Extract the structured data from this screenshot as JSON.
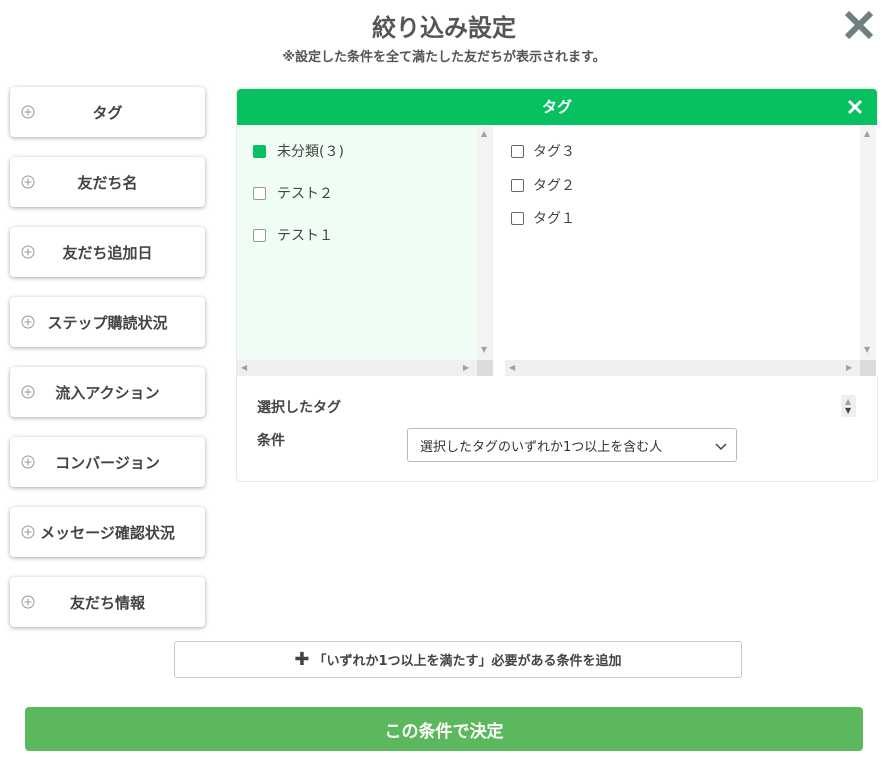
{
  "header": {
    "title": "絞り込み設定",
    "subtitle": "※設定した条件を全て満たした友だちが表示されます。"
  },
  "colors": {
    "accent": "#07c160",
    "confirm": "#5cb85c",
    "text": "#444444"
  },
  "sidebar": {
    "items": [
      {
        "label": "タグ",
        "icon": "plus-circle-icon"
      },
      {
        "label": "友だち名",
        "icon": "plus-circle-icon"
      },
      {
        "label": "友だち追加日",
        "icon": "plus-circle-icon"
      },
      {
        "label": "ステップ購読状況",
        "icon": "plus-circle-icon"
      },
      {
        "label": "流入アクション",
        "icon": "plus-circle-icon"
      },
      {
        "label": "コンバージョン",
        "icon": "plus-circle-icon"
      },
      {
        "label": "メッセージ確認状況",
        "icon": "plus-circle-icon"
      },
      {
        "label": "友だち情報",
        "icon": "plus-circle-icon"
      }
    ]
  },
  "tag_panel": {
    "title": "タグ",
    "folders": [
      {
        "label": "未分類(３)",
        "checked": true
      },
      {
        "label": "テスト２",
        "checked": false
      },
      {
        "label": "テスト１",
        "checked": false
      }
    ],
    "tags": [
      {
        "label": "タグ３",
        "checked": false
      },
      {
        "label": "タグ２",
        "checked": false
      },
      {
        "label": "タグ１",
        "checked": false
      }
    ],
    "selected_tags_label": "選択したタグ",
    "condition_label": "条件",
    "condition_value": "選択したタグのいずれか1つ以上を含む人"
  },
  "add_condition_label": "「いずれか1つ以上を満たす」必要がある条件を追加",
  "confirm_label": "この条件で決定"
}
